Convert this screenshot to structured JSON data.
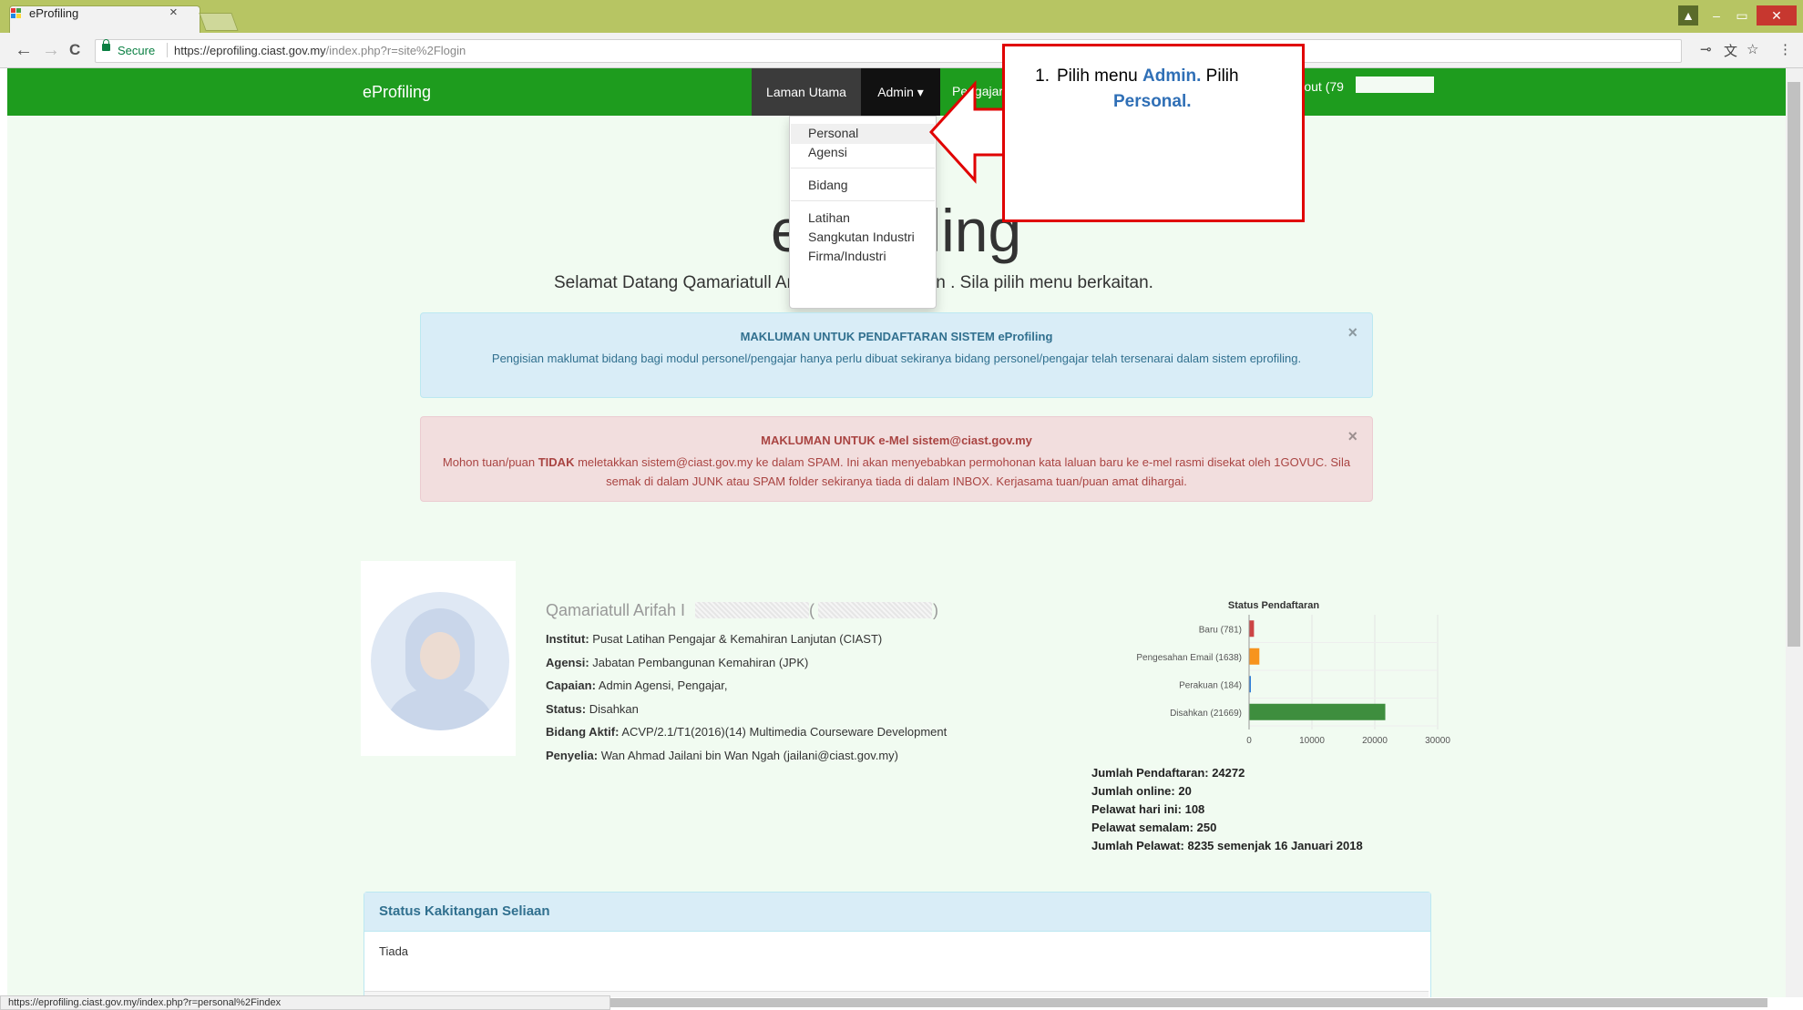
{
  "browser": {
    "tab_title": "eProfiling",
    "tab_close": "×",
    "secure_label": "Secure",
    "url_host": "https://eprofiling.ciast.gov.my",
    "url_path": "/index.php?r=site%2Flogin",
    "status_url": "https://eprofiling.ciast.gov.my/index.php?r=personal%2Findex",
    "back_icon": "←",
    "forward_icon": "→",
    "reload_icon": "C",
    "key_icon": "⊸",
    "translate_icon": "文",
    "star_icon": "☆",
    "menu_icon": "⋮",
    "min_icon": "–",
    "max_icon": "▭",
    "close_icon": "✕",
    "user_icon": "▲"
  },
  "navbar": {
    "brand": "eProfiling",
    "home": "Laman Utama",
    "admin": "Admin ▾",
    "pengajar": "Pengajar",
    "logout": "Logout (79"
  },
  "dropdown": {
    "items": [
      "Personal",
      "Agensi",
      "Bidang",
      "Latihan",
      "Sangkutan Industri",
      "Firma/Industri"
    ]
  },
  "hero": {
    "title": "eProfiling",
    "welcome": "Selamat Datang Qamariatull Arifah binti Kamarudin . Sila pilih menu berkaitan."
  },
  "alerts": {
    "info_title": "MAKLUMAN UNTUK PENDAFTARAN SISTEM eProfiling",
    "info_body": "Pengisian maklumat bidang bagi modul personel/pengajar hanya perlu dibuat sekiranya bidang personel/pengajar telah tersenarai dalam sistem eprofiling.",
    "danger_title": "MAKLUMAN UNTUK e-Mel sistem@ciast.gov.my",
    "danger_body_pre": "Mohon tuan/puan ",
    "danger_body_bold": "TIDAK",
    "danger_body_post": " meletakkan sistem@ciast.gov.my ke dalam SPAM. Ini akan menyebabkan permohonan kata laluan baru ke e-mel rasmi disekat oleh 1GOVUC. Sila semak di dalam JUNK atau SPAM folder sekiranya tiada di dalam INBOX. Kerjasama tuan/puan amat dihargai.",
    "close": "×"
  },
  "profile": {
    "name": "Qamariatull Arifah I",
    "paren_open": "(",
    "paren_close": ")",
    "institut_label": "Institut:",
    "institut": "Pusat Latihan Pengajar & Kemahiran Lanjutan (CIAST)",
    "agensi_label": "Agensi:",
    "agensi": "Jabatan Pembangunan Kemahiran (JPK)",
    "capaian_label": "Capaian:",
    "capaian": "Admin Agensi, Pengajar,",
    "status_label": "Status:",
    "status": "Disahkan",
    "bidang_label": "Bidang Aktif:",
    "bidang": "ACVP/2.1/T1(2016)(14) Multimedia Courseware Development",
    "penyelia_label": "Penyelia:",
    "penyelia": "Wan Ahmad Jailani bin Wan Ngah (jailani@ciast.gov.my)"
  },
  "chart_data": {
    "type": "bar",
    "orientation": "horizontal",
    "title": "Status Pendaftaran",
    "categories": [
      "Baru (781)",
      "Pengesahan Email (1638)",
      "Perakuan (184)",
      "Disahkan (21669)"
    ],
    "values": [
      781,
      1638,
      184,
      21669
    ],
    "colors": [
      "#c44",
      "#f7941d",
      "#2f7ed8",
      "#3e8e3e"
    ],
    "xlim": [
      0,
      30000
    ],
    "xticks": [
      "0",
      "10000",
      "20000",
      "30000"
    ],
    "grid": true
  },
  "stats": [
    "Jumlah Pendaftaran: 24272",
    "Jumlah online: 20",
    "Pelawat hari ini: 108",
    "Pelawat semalam: 250",
    "Jumlah Pelawat: 8235 semenjak 16 Januari 2018"
  ],
  "panel": {
    "title": "Status Kakitangan Seliaan",
    "body": "Tiada"
  },
  "callout": {
    "number": "1.",
    "pre": "Pilih menu ",
    "admin": "Admin.",
    "mid": " Pilih ",
    "personal": "Personal."
  }
}
